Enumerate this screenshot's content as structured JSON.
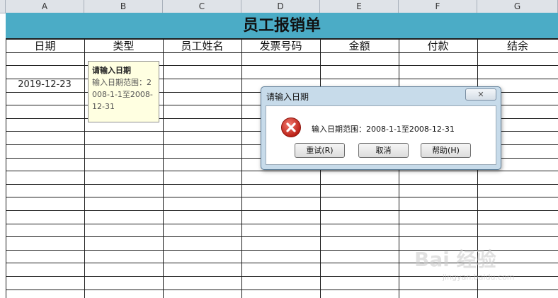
{
  "columns": [
    "A",
    "B",
    "C",
    "D",
    "E",
    "F",
    "G"
  ],
  "sheet": {
    "title": "员工报销单",
    "headers": [
      "日期",
      "类型",
      "员工姓名",
      "发票号码",
      "金额",
      "付款",
      "结余"
    ],
    "cell_a5": "2019-12-23"
  },
  "tooltip": {
    "title": "请输入日期",
    "body": "输入日期范围：2008-1-1至2008-12-31"
  },
  "dialog": {
    "title": "请输入日期",
    "message": "输入日期范围：2008-1-1至2008-12-31",
    "close_icon": "close-icon",
    "error_icon": "error-x-icon",
    "retry_label": "重试(R)",
    "cancel_label": "取消",
    "help_label": "帮助(H)"
  },
  "colors": {
    "banner": "#4bacc6",
    "tooltip_bg": "#ffffe1",
    "dialog_frame": "#c7dbea",
    "error_red": "#d9261c"
  },
  "watermark": {
    "logo": "Bai 经验",
    "url": "jingyan.baidu.com"
  }
}
